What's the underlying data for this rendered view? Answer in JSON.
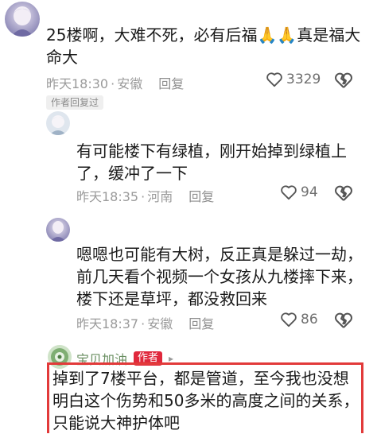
{
  "comments": [
    {
      "text": "25楼啊，大难不死，必有后福🙏🙏真是福大命大",
      "time": "昨天18:30",
      "location": "安徽",
      "reply_label": "回复",
      "likes": "3329",
      "tag": "作者回复过"
    },
    {
      "author": "",
      "text": "有可能楼下有绿植，刚开始掉到绿植上了，缓冲了一下",
      "time": "昨天18:35",
      "location": "河南",
      "reply_label": "回复",
      "likes": "94"
    },
    {
      "author": "",
      "text": "嗯嗯也可能有大树，反正真是躲过一劫，前几天看个视频一个女孩从九楼摔下来，楼下还是草坪，都没救回来",
      "time": "昨天18:37",
      "location": "安徽",
      "reply_label": "回复",
      "likes": "86"
    },
    {
      "author": "宝贝加油",
      "badge": "作者",
      "arrow": "▸",
      "text": "掉到了7楼平台，都是管道，至今我也没想明白这个伤势和50多米的高度之间的关系，只能说大神护体吧"
    }
  ],
  "separator": "·",
  "colors": {
    "highlight_border": "#e23a3a",
    "author_badge": "#e0283c",
    "author_name": "#6a8f62"
  }
}
